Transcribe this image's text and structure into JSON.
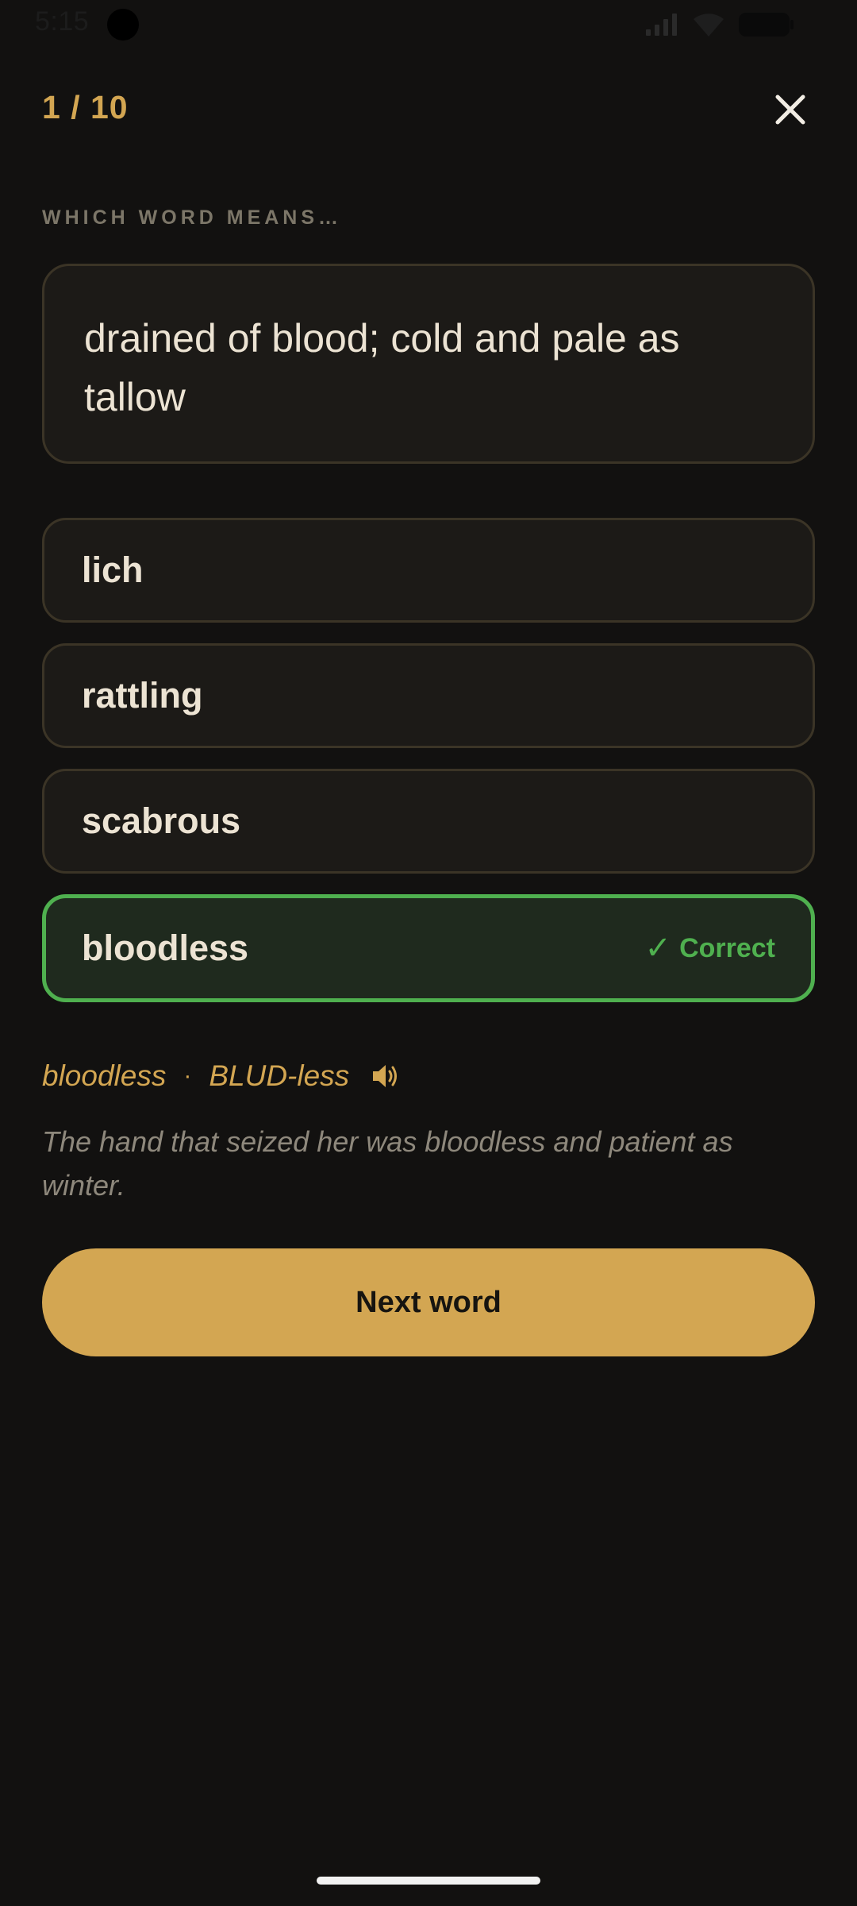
{
  "status_bar": {
    "time": "5:15",
    "icons": [
      "signal-icon",
      "wifi-icon",
      "battery-icon"
    ]
  },
  "header": {
    "progress": "1 / 10",
    "close_icon": "close-icon"
  },
  "prompt": {
    "label": "WHICH WORD MEANS…",
    "definition": "drained of blood; cold and pale as tallow"
  },
  "options": [
    {
      "label": "lich",
      "state": "default"
    },
    {
      "label": "rattling",
      "state": "default"
    },
    {
      "label": "scabrous",
      "state": "default"
    },
    {
      "label": "bloodless",
      "state": "correct"
    }
  ],
  "feedback": {
    "check": "✓",
    "text": "Correct"
  },
  "pronunciation": {
    "word": "bloodless",
    "separator": "·",
    "phonetic": "BLUD-less",
    "icon": "speaker-icon"
  },
  "example": "The hand that seized her was bloodless and patient as winter.",
  "next_button": {
    "label": "Next word"
  },
  "colors": {
    "background": "#121110",
    "accent": "#d3a652",
    "correct": "#4fb04f",
    "card": "#1c1a17",
    "border": "#3b3426"
  }
}
